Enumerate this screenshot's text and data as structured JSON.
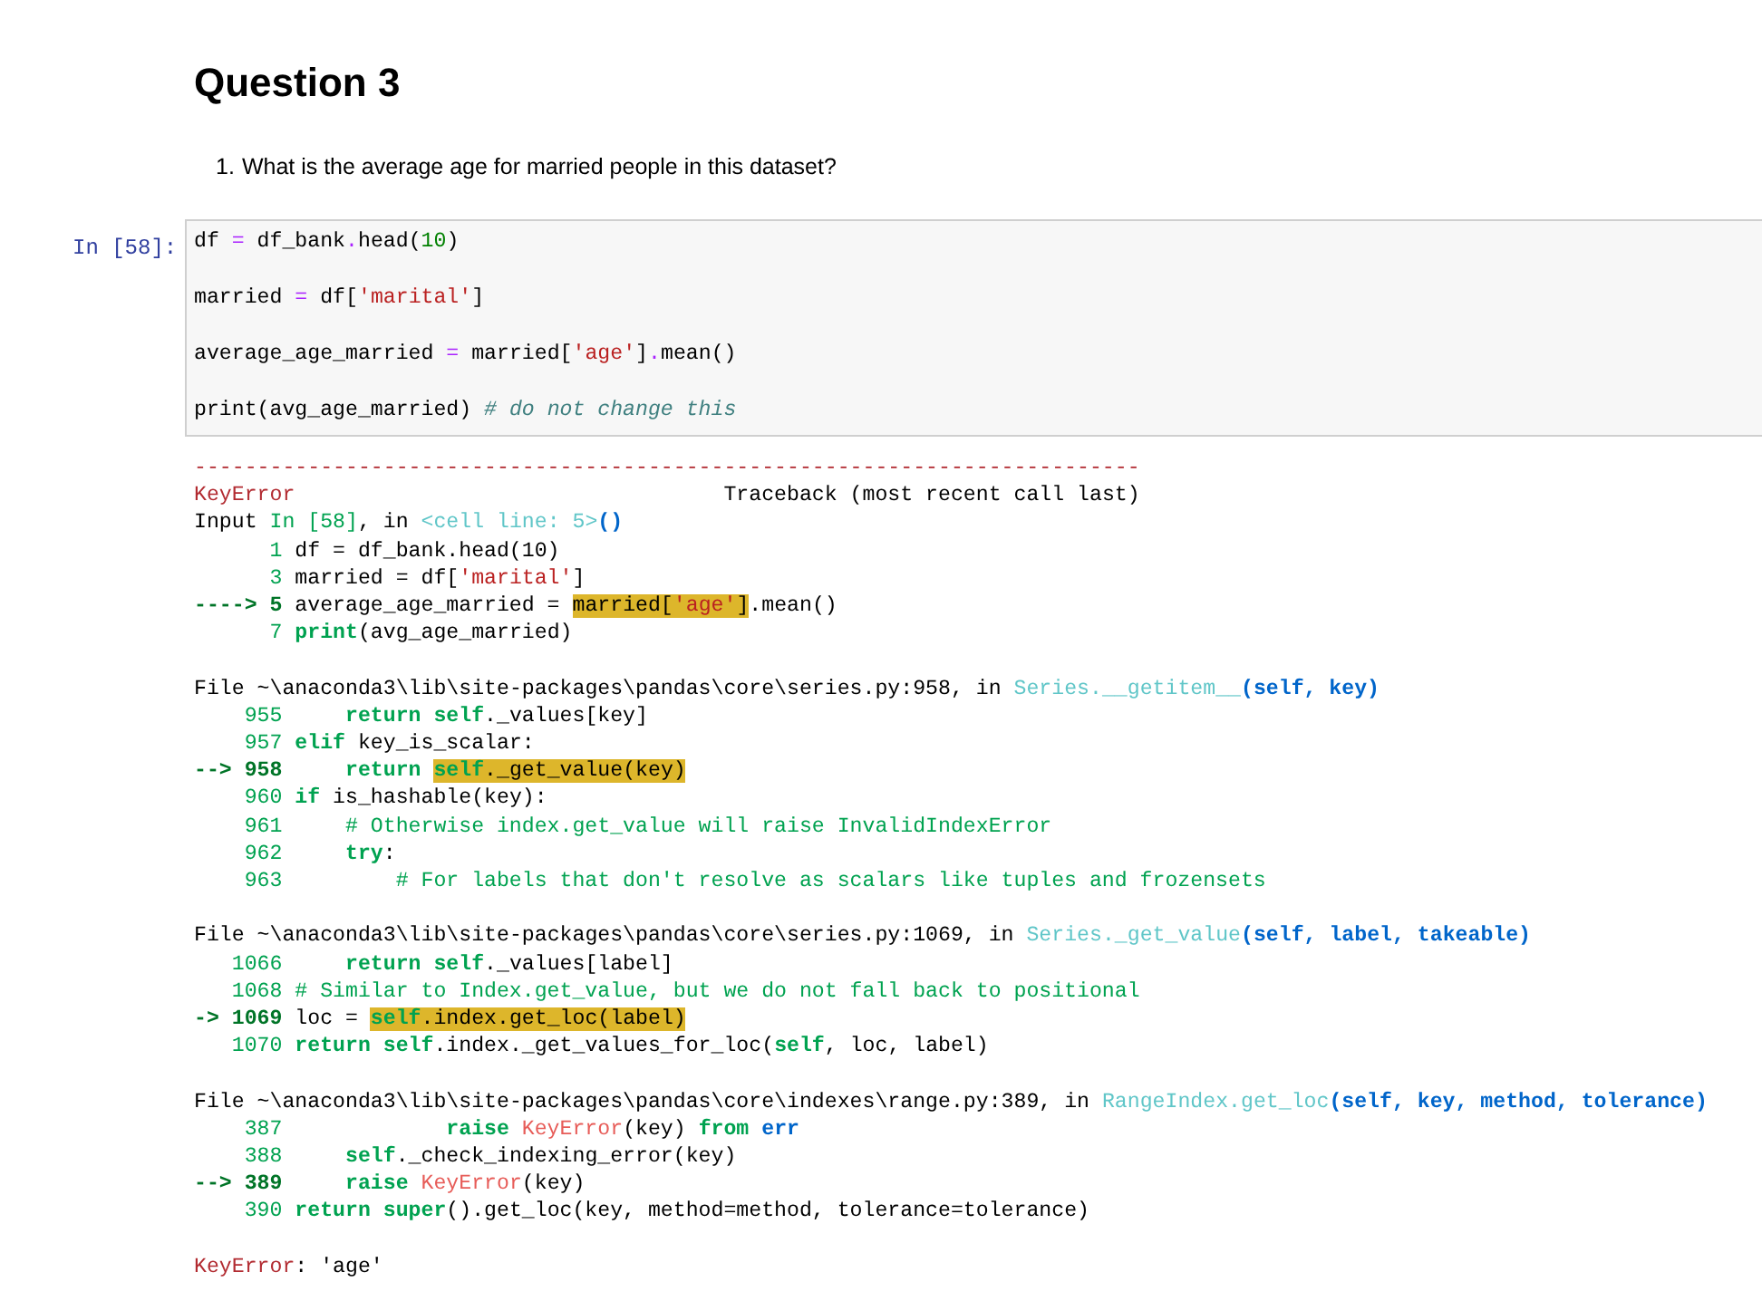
{
  "markdown": {
    "heading": "Question 3",
    "list": [
      {
        "marker": "1.",
        "text": "What is the average age for married people in this dataset?"
      }
    ]
  },
  "cell": {
    "prompt": "In [58]:",
    "lines": [
      [
        {
          "kind": "plain",
          "text": "df "
        },
        {
          "kind": "operator",
          "text": "="
        },
        {
          "kind": "plain",
          "text": " df_bank"
        },
        {
          "kind": "operator",
          "text": "."
        },
        {
          "kind": "plain",
          "text": "head("
        },
        {
          "kind": "number",
          "text": "10"
        },
        {
          "kind": "plain",
          "text": ")"
        }
      ],
      [
        {
          "kind": "plain",
          "text": "married "
        },
        {
          "kind": "operator",
          "text": "="
        },
        {
          "kind": "plain",
          "text": " df["
        },
        {
          "kind": "string",
          "text": "'marital'"
        },
        {
          "kind": "plain",
          "text": "]"
        }
      ],
      [
        {
          "kind": "plain",
          "text": "average_age_married "
        },
        {
          "kind": "operator",
          "text": "="
        },
        {
          "kind": "plain",
          "text": " married["
        },
        {
          "kind": "string",
          "text": "'age'"
        },
        {
          "kind": "plain",
          "text": "]"
        },
        {
          "kind": "operator",
          "text": "."
        },
        {
          "kind": "plain",
          "text": "mean()"
        }
      ],
      [
        {
          "kind": "plain",
          "text": "print(avg_age_married) "
        },
        {
          "kind": "comment",
          "text": "# do not change this"
        }
      ]
    ]
  },
  "output": {
    "blocks": [
      [
        [
          {
            "kind": "excname",
            "text": "---------------------------------------------------------------------------"
          }
        ],
        [
          {
            "kind": "excname",
            "text": "KeyError"
          },
          {
            "kind": "plain",
            "text": "                                  Traceback (most recent call last)"
          }
        ],
        [
          {
            "kind": "plain",
            "text": "Input "
          },
          {
            "kind": "lineno",
            "text": "In [58]"
          },
          {
            "kind": "plain",
            "text": ", in "
          },
          {
            "kind": "link",
            "text": "<cell line: 5>"
          },
          {
            "kind": "args",
            "text": "()"
          }
        ],
        [
          {
            "kind": "lineno",
            "text": "      1"
          },
          {
            "kind": "plain",
            "text": " df = df_bank.head(10)"
          }
        ],
        [
          {
            "kind": "lineno",
            "text": "      3"
          },
          {
            "kind": "plain",
            "text": " married = df["
          },
          {
            "kind": "string",
            "text": "'marital'"
          },
          {
            "kind": "plain",
            "text": "]"
          }
        ],
        [
          {
            "kind": "arrow",
            "text": "----> 5"
          },
          {
            "kind": "plain",
            "text": " average_age_married = "
          },
          {
            "kind": "plain",
            "text": "married[",
            "highlighted": true
          },
          {
            "kind": "string",
            "text": "'age'",
            "highlighted": true
          },
          {
            "kind": "plain",
            "text": "]",
            "highlighted": true
          },
          {
            "kind": "plain",
            "text": ".mean()"
          }
        ],
        [
          {
            "kind": "lineno",
            "text": "      7"
          },
          {
            "kind": "keyword",
            "text": " print"
          },
          {
            "kind": "plain",
            "text": "(avg_age_married)"
          }
        ]
      ],
      [
        [
          {
            "kind": "plain",
            "text": "File "
          },
          {
            "kind": "path",
            "text": "~\\anaconda3\\lib\\site-packages\\pandas\\core\\series.py:958"
          },
          {
            "kind": "plain",
            "text": ", in "
          },
          {
            "kind": "link",
            "text": "Series.__getitem__"
          },
          {
            "kind": "args",
            "text": "(self, key)"
          }
        ],
        [
          {
            "kind": "lineno",
            "text": "    955"
          },
          {
            "kind": "keyword",
            "text": "     return"
          },
          {
            "kind": "keyword",
            "text": " self"
          },
          {
            "kind": "plain",
            "text": "._values[key]"
          }
        ],
        [
          {
            "kind": "lineno",
            "text": "    957"
          },
          {
            "kind": "keyword",
            "text": " elif"
          },
          {
            "kind": "plain",
            "text": " key_is_scalar:"
          }
        ],
        [
          {
            "kind": "arrow",
            "text": "--> 958"
          },
          {
            "kind": "keyword",
            "text": "     return "
          },
          {
            "kind": "keyword",
            "text": "self",
            "highlighted": true
          },
          {
            "kind": "plain",
            "text": "._get_value(key)",
            "highlighted": true
          }
        ],
        [
          {
            "kind": "lineno",
            "text": "    960"
          },
          {
            "kind": "keyword",
            "text": " if"
          },
          {
            "kind": "plain",
            "text": " is_hashable(key):"
          }
        ],
        [
          {
            "kind": "lineno",
            "text": "    961"
          },
          {
            "kind": "comment",
            "text": "     # Otherwise index.get_value will raise InvalidIndexError"
          }
        ],
        [
          {
            "kind": "lineno",
            "text": "    962"
          },
          {
            "kind": "keyword",
            "text": "     try"
          },
          {
            "kind": "plain",
            "text": ":"
          }
        ],
        [
          {
            "kind": "lineno",
            "text": "    963"
          },
          {
            "kind": "comment",
            "text": "         # For labels that don't resolve as scalars like tuples and frozensets"
          }
        ]
      ],
      [
        [
          {
            "kind": "plain",
            "text": "File "
          },
          {
            "kind": "path",
            "text": "~\\anaconda3\\lib\\site-packages\\pandas\\core\\series.py:1069"
          },
          {
            "kind": "plain",
            "text": ", in "
          },
          {
            "kind": "link",
            "text": "Series._get_value"
          },
          {
            "kind": "args",
            "text": "(self, label, takeable)"
          }
        ],
        [
          {
            "kind": "lineno",
            "text": "   1066"
          },
          {
            "kind": "keyword",
            "text": "     return"
          },
          {
            "kind": "keyword",
            "text": " self"
          },
          {
            "kind": "plain",
            "text": "._values[label]"
          }
        ],
        [
          {
            "kind": "lineno",
            "text": "   1068"
          },
          {
            "kind": "comment",
            "text": " # Similar to Index.get_value, but we do not fall back to positional"
          }
        ],
        [
          {
            "kind": "arrow",
            "text": "-> 1069"
          },
          {
            "kind": "plain",
            "text": " loc = "
          },
          {
            "kind": "keyword",
            "text": "self",
            "highlighted": true
          },
          {
            "kind": "plain",
            "text": ".index.get_loc(label)",
            "highlighted": true
          }
        ],
        [
          {
            "kind": "lineno",
            "text": "   1070"
          },
          {
            "kind": "keyword",
            "text": " return"
          },
          {
            "kind": "keyword",
            "text": " self"
          },
          {
            "kind": "plain",
            "text": ".index._get_values_for_loc("
          },
          {
            "kind": "keyword",
            "text": "self"
          },
          {
            "kind": "plain",
            "text": ", loc, label)"
          }
        ]
      ],
      [
        [
          {
            "kind": "plain",
            "text": "File "
          },
          {
            "kind": "path",
            "text": "~\\anaconda3\\lib\\site-packages\\pandas\\core\\indexes\\range.py:389"
          },
          {
            "kind": "plain",
            "text": ", in "
          },
          {
            "kind": "link",
            "text": "RangeIndex.get_loc"
          },
          {
            "kind": "args",
            "text": "(self, key, method, tolerance)"
          }
        ],
        [
          {
            "kind": "lineno",
            "text": "    387"
          },
          {
            "kind": "keyword",
            "text": "             raise"
          },
          {
            "kind": "errname",
            "text": " KeyError"
          },
          {
            "kind": "plain",
            "text": "(key) "
          },
          {
            "kind": "keyword",
            "text": "from"
          },
          {
            "kind": "args",
            "text": " err"
          }
        ],
        [
          {
            "kind": "lineno",
            "text": "    388"
          },
          {
            "kind": "keyword",
            "text": "     self"
          },
          {
            "kind": "plain",
            "text": "._check_indexing_error(key)"
          }
        ],
        [
          {
            "kind": "arrow",
            "text": "--> 389"
          },
          {
            "kind": "keyword",
            "text": "     raise"
          },
          {
            "kind": "errname",
            "text": " KeyError"
          },
          {
            "kind": "plain",
            "text": "(key)"
          }
        ],
        [
          {
            "kind": "lineno",
            "text": "    390"
          },
          {
            "kind": "keyword",
            "text": " return"
          },
          {
            "kind": "keyword",
            "text": " super"
          },
          {
            "kind": "plain",
            "text": "().get_loc(key, method=method, tolerance=tolerance)"
          }
        ]
      ],
      [
        [
          {
            "kind": "excname",
            "text": "KeyError"
          },
          {
            "kind": "plain",
            "text": ": 'age'"
          }
        ]
      ]
    ]
  }
}
